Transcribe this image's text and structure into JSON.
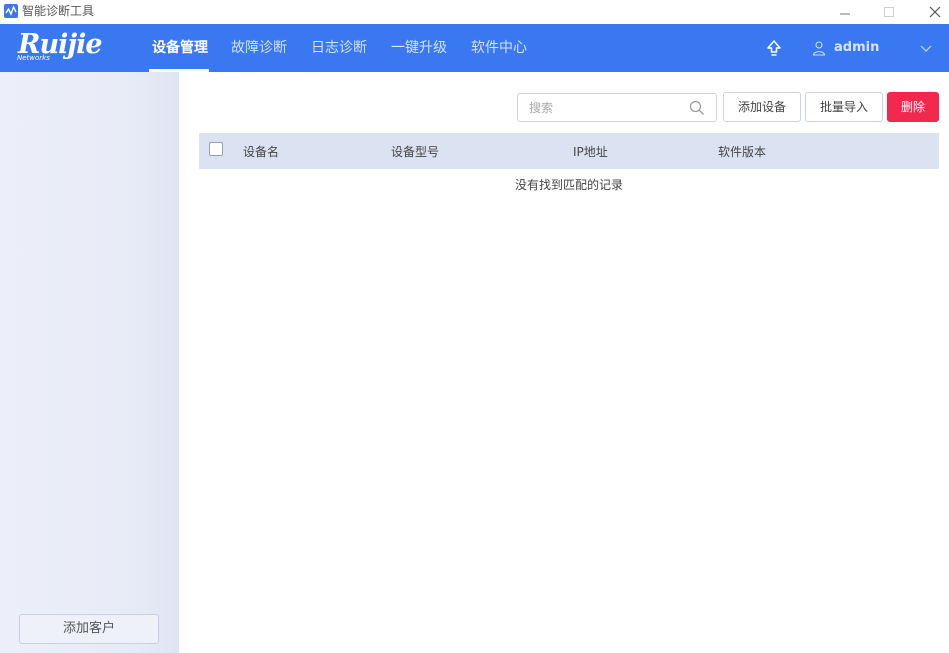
{
  "window": {
    "title": "智能诊断工具",
    "icon": "pulse-icon"
  },
  "nav": {
    "brand": "Ruijie",
    "brand_sub": "Networks",
    "items": [
      {
        "label": "设备管理",
        "active": true
      },
      {
        "label": "故障诊断",
        "active": false
      },
      {
        "label": "日志诊断",
        "active": false
      },
      {
        "label": "一键升级",
        "active": false
      },
      {
        "label": "软件中心",
        "active": false
      }
    ],
    "user": "admin",
    "accent": "#3a78f2"
  },
  "sidebar": {
    "add_customer_label": "添加客户"
  },
  "toolbar": {
    "search_placeholder": "搜索",
    "add_device_label": "添加设备",
    "batch_import_label": "批量导入",
    "delete_label": "删除",
    "delete_color": "#f2284f"
  },
  "table": {
    "columns": [
      "设备名",
      "设备型号",
      "IP地址",
      "软件版本"
    ],
    "empty_message": "没有找到匹配的记录"
  }
}
